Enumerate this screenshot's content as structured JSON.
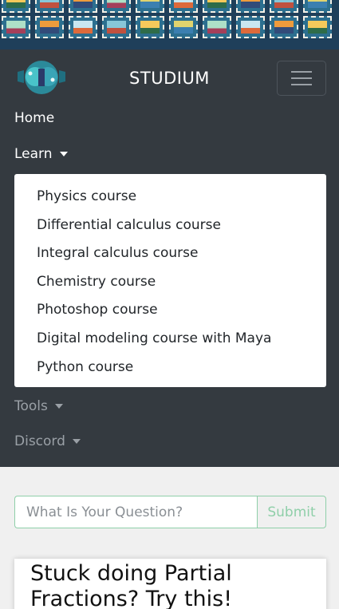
{
  "brand": {
    "title": "STUDIUM",
    "logo_icon": "brain-logo-icon"
  },
  "nav": {
    "items": [
      {
        "label": "Home",
        "has_caret": false
      },
      {
        "label": "Learn",
        "has_caret": true,
        "expanded": true
      },
      {
        "label": "Tools",
        "has_caret": true
      },
      {
        "label": "Discord",
        "has_caret": true
      }
    ],
    "learn_menu": [
      "Physics course",
      "Differential calculus course",
      "Integral calculus course",
      "Chemistry course",
      "Photoshop course",
      "Digital modeling course with Maya",
      "Python course"
    ]
  },
  "search": {
    "placeholder": "What Is Your Question?",
    "submit_label": "Submit"
  },
  "article": {
    "title": "Stuck doing Partial Fractions? Try this!"
  },
  "colors": {
    "navbar_bg": "#343a40",
    "accent_green": "#8fcfa9",
    "page_bg": "#f0f0f0"
  }
}
